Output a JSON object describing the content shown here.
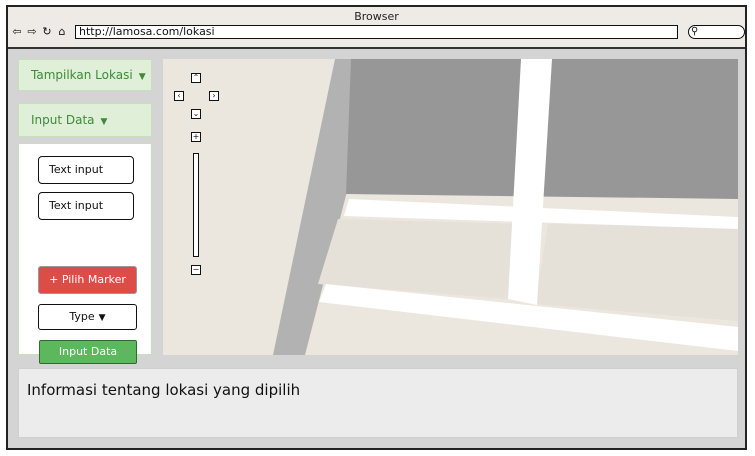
{
  "window": {
    "title": "Browser",
    "url": "http://lamosa.com/lokasi",
    "nav_icons": [
      "back-arrow-icon",
      "forward-arrow-icon",
      "reload-icon",
      "home-icon"
    ],
    "search_icon": "search-icon"
  },
  "sidebar": {
    "tampilkan_lokasi": "Tampilkan Lokasi",
    "input_data_header": "Input Data",
    "fields": [
      "Text input",
      "Text input"
    ],
    "pilih_marker": "+ Pilih Marker",
    "type_dropdown": "Type",
    "submit": "Input Data",
    "colors": {
      "header_bg": "#dfefd8",
      "header_text": "#3e8a3a",
      "marker_button": "#dd4d48",
      "submit_button": "#5cb85c"
    }
  },
  "map": {
    "controls": [
      "pan-up-icon",
      "pan-left-icon",
      "pan-right-icon",
      "pan-down-icon",
      "zoom-in-icon",
      "zoom-out-icon"
    ],
    "up": "⌃",
    "left": "‹",
    "right": "›",
    "down": "⌄",
    "zoom_in": "+",
    "zoom_out": "−",
    "colors": {
      "land": "#ebe7de",
      "block": "#979797",
      "road": "#ffffff",
      "highway": "#b2b2b2"
    }
  },
  "info": {
    "text": "Informasi tentang lokasi yang dipilih"
  }
}
